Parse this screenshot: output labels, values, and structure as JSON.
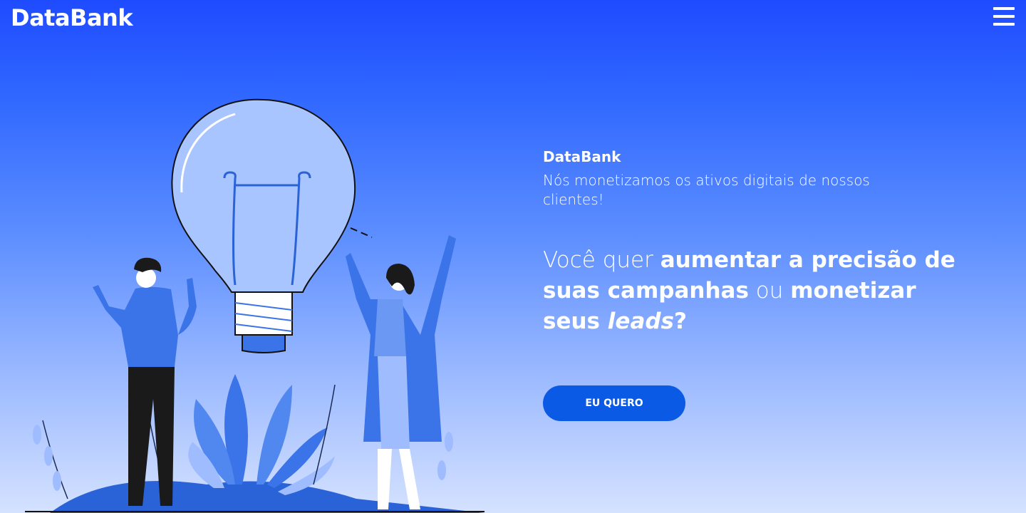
{
  "header": {
    "logo": "DataBank",
    "menu_icon": "hamburger-menu-icon"
  },
  "hero": {
    "brand": "DataBank",
    "tagline": "Nós monetizamos os ativos digitais de nossos clientes!",
    "headline": {
      "p1": "Você quer ",
      "b1": "aumentar a precisão de suas campanhas",
      "p2": " ou ",
      "b2": "monetizar seus ",
      "em": "leads",
      "p3": "?"
    },
    "cta_label": "EU QUERO"
  },
  "colors": {
    "accent": "#0b5ae6",
    "top_gradient": "#1f4bff",
    "bottom_gradient": "#d5e2ff"
  }
}
